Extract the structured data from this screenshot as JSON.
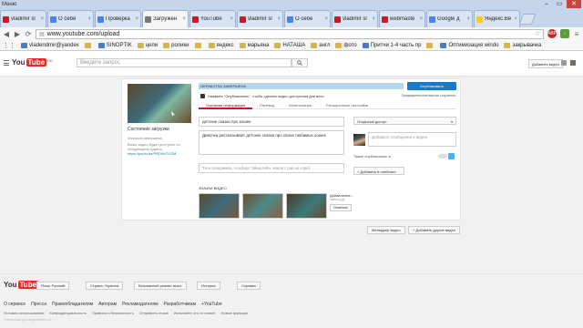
{
  "browser": {
    "menu_label": "Меню",
    "tabs": [
      {
        "title": "vladimir sl",
        "color": "#cc181e",
        "active": false
      },
      {
        "title": "О себе",
        "color": "#4285f4",
        "active": false
      },
      {
        "title": "Проверка",
        "color": "#4285f4",
        "active": false
      },
      {
        "title": "Загружен",
        "color": "#777777",
        "active": true
      },
      {
        "title": "YouTube",
        "color": "#cc181e",
        "active": false
      },
      {
        "title": "vladimir sl",
        "color": "#cc181e",
        "active": false
      },
      {
        "title": "О себе",
        "color": "#4285f4",
        "active": false
      },
      {
        "title": "vladimir sl",
        "color": "#cc181e",
        "active": false
      },
      {
        "title": "webmaste",
        "color": "#cc181e",
        "active": false
      },
      {
        "title": "Google д",
        "color": "#4285f4",
        "active": false
      },
      {
        "title": "Яндекс.Ве",
        "color": "#ffcc00",
        "active": false
      }
    ],
    "url": "www.youtube.com/upload",
    "extension_badge": "ABP",
    "bookmarks": [
      {
        "label": "vladendmir@yandex",
        "kind": "site"
      },
      {
        "label": "",
        "kind": "folder"
      },
      {
        "label": "SINOPTIK",
        "kind": "site"
      },
      {
        "label": "цепи",
        "kind": "folder"
      },
      {
        "label": "ролики",
        "kind": "folder"
      },
      {
        "label": "",
        "kind": "folder"
      },
      {
        "label": "яндекс",
        "kind": "folder"
      },
      {
        "label": "марьяна",
        "kind": "folder"
      },
      {
        "label": "НАТАША",
        "kind": "folder"
      },
      {
        "label": "англ",
        "kind": "folder"
      },
      {
        "label": "фото",
        "kind": "folder"
      },
      {
        "label": "Притчи 1-4 часть пр",
        "kind": "site"
      },
      {
        "label": "",
        "kind": "folder"
      },
      {
        "label": "Оптимизация windo",
        "kind": "site"
      },
      {
        "label": "закрывачка",
        "kind": "folder"
      }
    ]
  },
  "yt_header": {
    "logo_prefix": "You",
    "logo_tube": "Tube",
    "country": "RU",
    "search_placeholder": "Введите запрос",
    "add_video": "Добавить видео"
  },
  "upload": {
    "status_title": "Состояние загрузки",
    "status_sub": "Загрузка завершена",
    "status_text": "Ваше видео будет доступно по следующему адресу",
    "status_link": "https://youtu.be/PRD9N7GSM",
    "progress_text": "ОБРАБОТКА ЗАВЕРШЕНА",
    "progress_fraction": 1.0,
    "publish_button": "Опубликовать",
    "info_text": "Нажмите \"Опубликовать\", чтобы сделать видео доступным для всех.",
    "info_link": "Предварительная версия сохранена.",
    "tabs": [
      "Основная информация",
      "Перевод",
      "Монетизация",
      "Расширенные настройки"
    ],
    "title_value": "детские сказки про кошек",
    "description_value": "Девочка рассказывает детские сказки про своих любимых кошек",
    "tags_placeholder": "Теги (например, Альберт Эйнштейн, машет, рак на горе)",
    "privacy_value": "Открытый доступ",
    "comment_placeholder": "Добавьте сообщение к видео",
    "share_label": "Также опубликовать в",
    "playlist_button": "+ Добавить в плейлист",
    "thumbs_label": "ЗНАЧКИ ВИДЕО",
    "custom_thumb_title": "Добавление...",
    "custom_thumb_sub": "значок.jpg",
    "custom_thumb_btn": "Отменить",
    "manager_button": "Менеджер видео",
    "add_more_button": "+ Добавить другие видео"
  },
  "footer": {
    "language": "Язык: Русский",
    "country": "Страна: Украина",
    "safety": "Безопасный режим: выкл.",
    "history": "История",
    "help": "Справка",
    "links": [
      "О сервисе",
      "Пресса",
      "Правообладателям",
      "Авторам",
      "Рекламодателям",
      "Разработчикам",
      "+YouTube"
    ],
    "links2": [
      "Условия использования",
      "Конфиденциальность",
      "Правила и безопасность",
      "Отправить отзыв",
      "Испытайте что-то новое!",
      "Новые функции"
    ],
    "faint": "Платформа для видеоблогеров"
  }
}
